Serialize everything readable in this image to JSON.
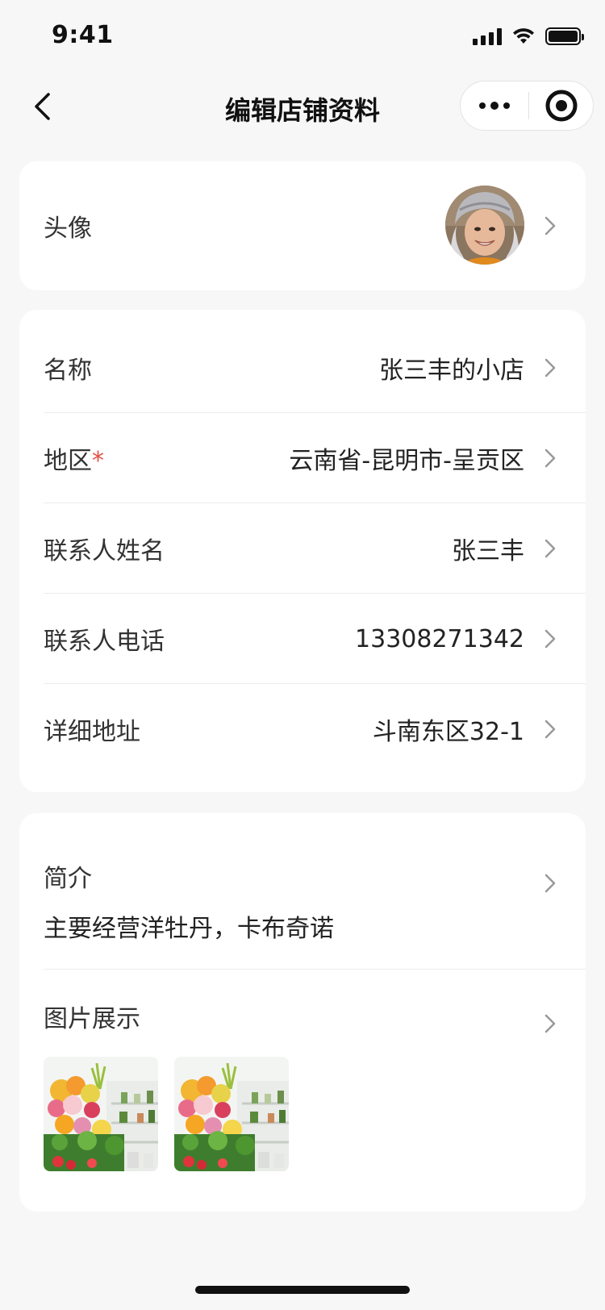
{
  "status_bar": {
    "time": "9:41"
  },
  "nav": {
    "title": "编辑店铺资料"
  },
  "avatar_row": {
    "label": "头像"
  },
  "info": {
    "name": {
      "label": "名称",
      "value": "张三丰的小店"
    },
    "region": {
      "label": "地区",
      "required_mark": "*",
      "value": "云南省-昆明市-呈贡区"
    },
    "contact_name": {
      "label": "联系人姓名",
      "value": "张三丰"
    },
    "contact_phone": {
      "label": "联系人电话",
      "value": "13308271342"
    },
    "address": {
      "label": "详细地址",
      "value": "斗南东区32-1"
    }
  },
  "intro": {
    "label": "简介",
    "text": "主要经营洋牡丹，卡布奇诺"
  },
  "gallery": {
    "label": "图片展示",
    "image_count": 2
  },
  "colors": {
    "background": "#f7f7f7",
    "card": "#ffffff",
    "required": "#e54d42"
  }
}
